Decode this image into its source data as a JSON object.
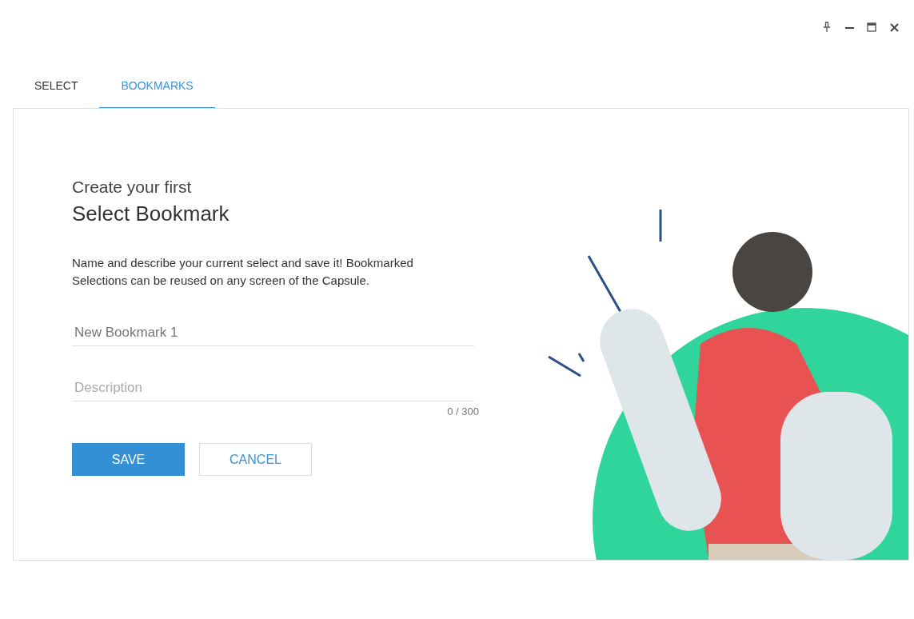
{
  "tabs": [
    {
      "label": "SELECT",
      "selected": false
    },
    {
      "label": "BOOKMARKS",
      "selected": true
    }
  ],
  "form": {
    "subtitle": "Create your first",
    "title": "Select Bookmark",
    "description": "Name and describe your current select and save it! Bookmarked Selections can be reused on any screen of the Capsule.",
    "name_field": {
      "value": "New Bookmark 1"
    },
    "description_field": {
      "placeholder": "Description",
      "counter": "0 / 300"
    },
    "buttons": [
      {
        "label": "SAVE",
        "kind": "primary"
      },
      {
        "label": "CANCEL",
        "kind": "secondary"
      }
    ]
  }
}
